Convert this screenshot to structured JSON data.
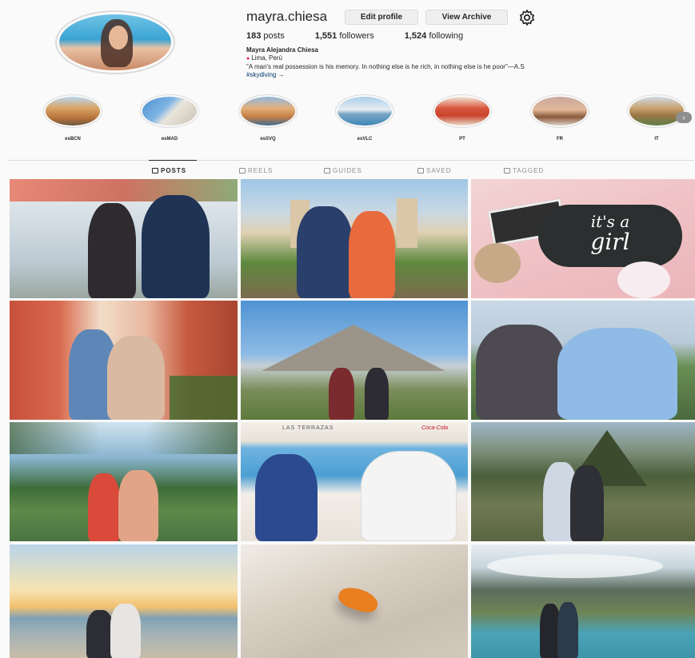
{
  "profile": {
    "username": "mayra.chiesa",
    "edit_profile_label": "Edit profile",
    "view_archive_label": "View Archive",
    "settings_icon": "gear-icon"
  },
  "stats": {
    "posts_count": "183",
    "posts_label": "posts",
    "followers_count": "1,551",
    "followers_label": "followers",
    "following_count": "1,524",
    "following_label": "following"
  },
  "bio": {
    "full_name": "Mayra Alejandra Chiesa",
    "location": "Lima, Perú",
    "quote": "\"A man's real possession is his memory. In nothing else is he rich, in nothing else is he poor\"—A.S",
    "hashtag": "#skydiving",
    "hashtag_suffix": " →"
  },
  "highlights": [
    {
      "label": "esBCN"
    },
    {
      "label": "esMAD"
    },
    {
      "label": "esSVQ"
    },
    {
      "label": "esVLC"
    },
    {
      "label": "PT"
    },
    {
      "label": "FR"
    },
    {
      "label": "IT"
    }
  ],
  "tabs": [
    {
      "label": "POSTS",
      "icon": "grid-icon",
      "active": true
    },
    {
      "label": "REELS",
      "icon": "reels-icon",
      "active": false
    },
    {
      "label": "GUIDES",
      "icon": "guides-icon",
      "active": false
    },
    {
      "label": "SAVED",
      "icon": "bookmark-icon",
      "active": false
    },
    {
      "label": "TAGGED",
      "icon": "tag-icon",
      "active": false
    }
  ],
  "posts": [
    {
      "alt": "couple by white wall"
    },
    {
      "alt": "couple in plaza with cathedral"
    },
    {
      "alt": "it's a girl sign"
    },
    {
      "alt": "couple in red alley"
    },
    {
      "alt": "couple at pyramid"
    },
    {
      "alt": "couple in stadium"
    },
    {
      "alt": "couple by lagoon"
    },
    {
      "alt": "couple at seaside terrace"
    },
    {
      "alt": "couple at mountain ruins"
    },
    {
      "alt": "couple on beach at sunset"
    },
    {
      "alt": "butterfly on floor"
    },
    {
      "alt": "couple at glacier lake"
    }
  ],
  "post_texts": {
    "terrace_sign": "LAS TERRAZAS",
    "terrace_brand": "Coca-Cola",
    "girl_sign_line1": "it's a",
    "girl_sign_line2": "girl"
  },
  "colors": {
    "link": "#00376b",
    "border": "#dbdbdb",
    "muted": "#8e8e8e"
  }
}
